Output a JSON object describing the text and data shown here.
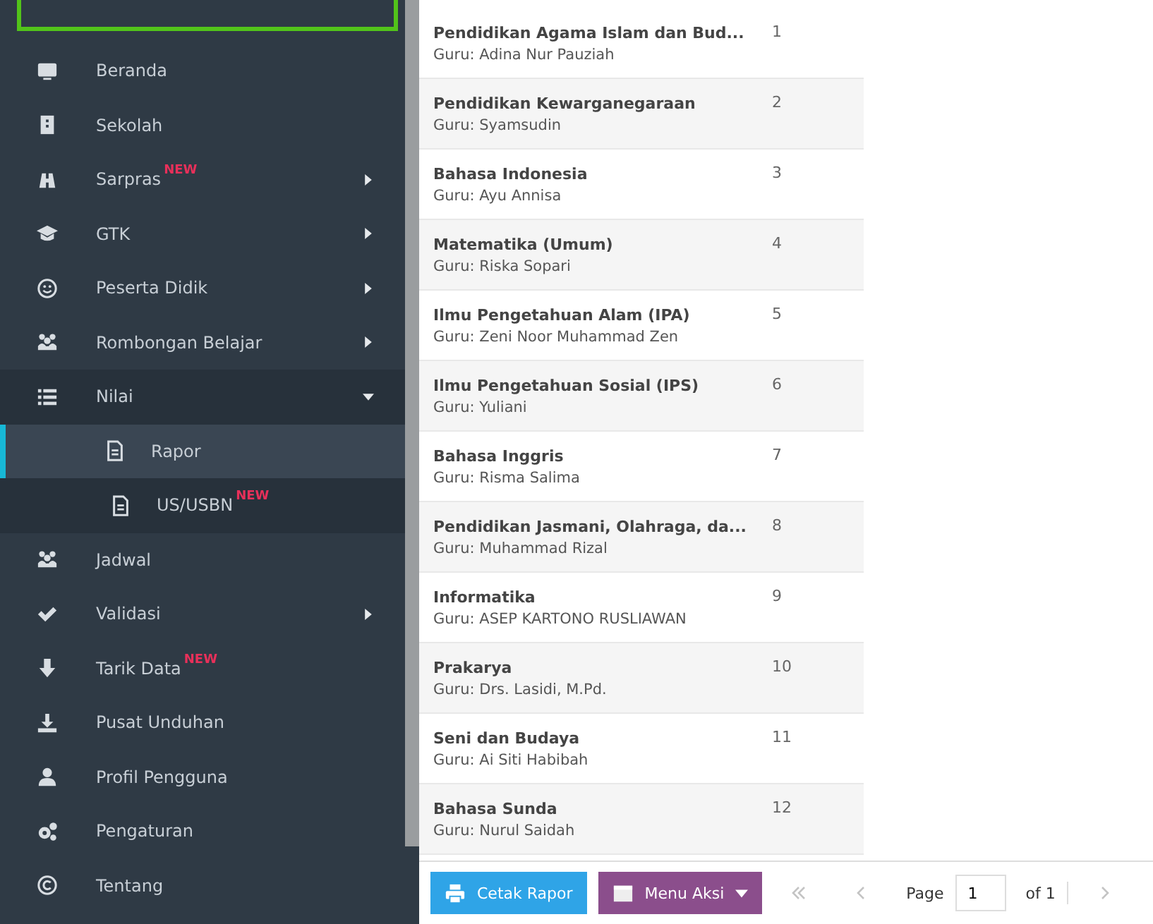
{
  "sidebar": {
    "items": [
      {
        "label": "Beranda",
        "has_submenu": false
      },
      {
        "label": "Sekolah",
        "has_submenu": false
      },
      {
        "label": "Sarpras",
        "badge": "NEW",
        "has_submenu": true,
        "expanded": false
      },
      {
        "label": "GTK",
        "has_submenu": true,
        "expanded": false
      },
      {
        "label": "Peserta Didik",
        "has_submenu": true,
        "expanded": false
      },
      {
        "label": "Rombongan Belajar",
        "has_submenu": true,
        "expanded": false
      },
      {
        "label": "Nilai",
        "has_submenu": true,
        "expanded": true,
        "children": [
          {
            "label": "Rapor",
            "selected": true
          },
          {
            "label": "US/USBN",
            "badge": "NEW",
            "selected": false
          }
        ]
      },
      {
        "label": "Jadwal",
        "has_submenu": false
      },
      {
        "label": "Validasi",
        "has_submenu": true,
        "expanded": false
      },
      {
        "label": "Tarik Data",
        "badge": "NEW",
        "has_submenu": false
      },
      {
        "label": "Pusat Unduhan",
        "has_submenu": false
      },
      {
        "label": "Profil Pengguna",
        "has_submenu": false
      },
      {
        "label": "Pengaturan",
        "has_submenu": false
      },
      {
        "label": "Tentang",
        "has_submenu": false
      }
    ]
  },
  "subjects": [
    {
      "name": "Pendidikan Agama Islam dan Bud...",
      "teacher": "Guru: Adina Nur Pauziah",
      "number": "1"
    },
    {
      "name": "Pendidikan Kewarganegaraan",
      "teacher": "Guru: Syamsudin",
      "number": "2"
    },
    {
      "name": "Bahasa Indonesia",
      "teacher": "Guru: Ayu Annisa",
      "number": "3"
    },
    {
      "name": "Matematika (Umum)",
      "teacher": "Guru: Riska Sopari",
      "number": "4"
    },
    {
      "name": "Ilmu Pengetahuan Alam (IPA)",
      "teacher": "Guru: Zeni Noor Muhammad Zen",
      "number": "5"
    },
    {
      "name": "Ilmu Pengetahuan Sosial (IPS)",
      "teacher": "Guru: Yuliani",
      "number": "6"
    },
    {
      "name": "Bahasa Inggris",
      "teacher": "Guru: Risma Salima",
      "number": "7"
    },
    {
      "name": "Pendidikan Jasmani, Olahraga, da...",
      "teacher": "Guru: Muhammad Rizal",
      "number": "8"
    },
    {
      "name": "Informatika",
      "teacher": "Guru: ASEP KARTONO RUSLIAWAN",
      "number": "9"
    },
    {
      "name": "Prakarya",
      "teacher": "Guru: Drs. Lasidi, M.Pd.",
      "number": "10"
    },
    {
      "name": "Seni dan Budaya",
      "teacher": "Guru: Ai Siti Habibah",
      "number": "11"
    },
    {
      "name": "Bahasa Sunda",
      "teacher": "Guru: Nurul Saidah",
      "number": "12"
    }
  ],
  "toolbar": {
    "print_button": "Cetak Rapor",
    "action_menu": "Menu Aksi",
    "page_label": "Page",
    "page_input": "1",
    "page_total": "of 1"
  }
}
